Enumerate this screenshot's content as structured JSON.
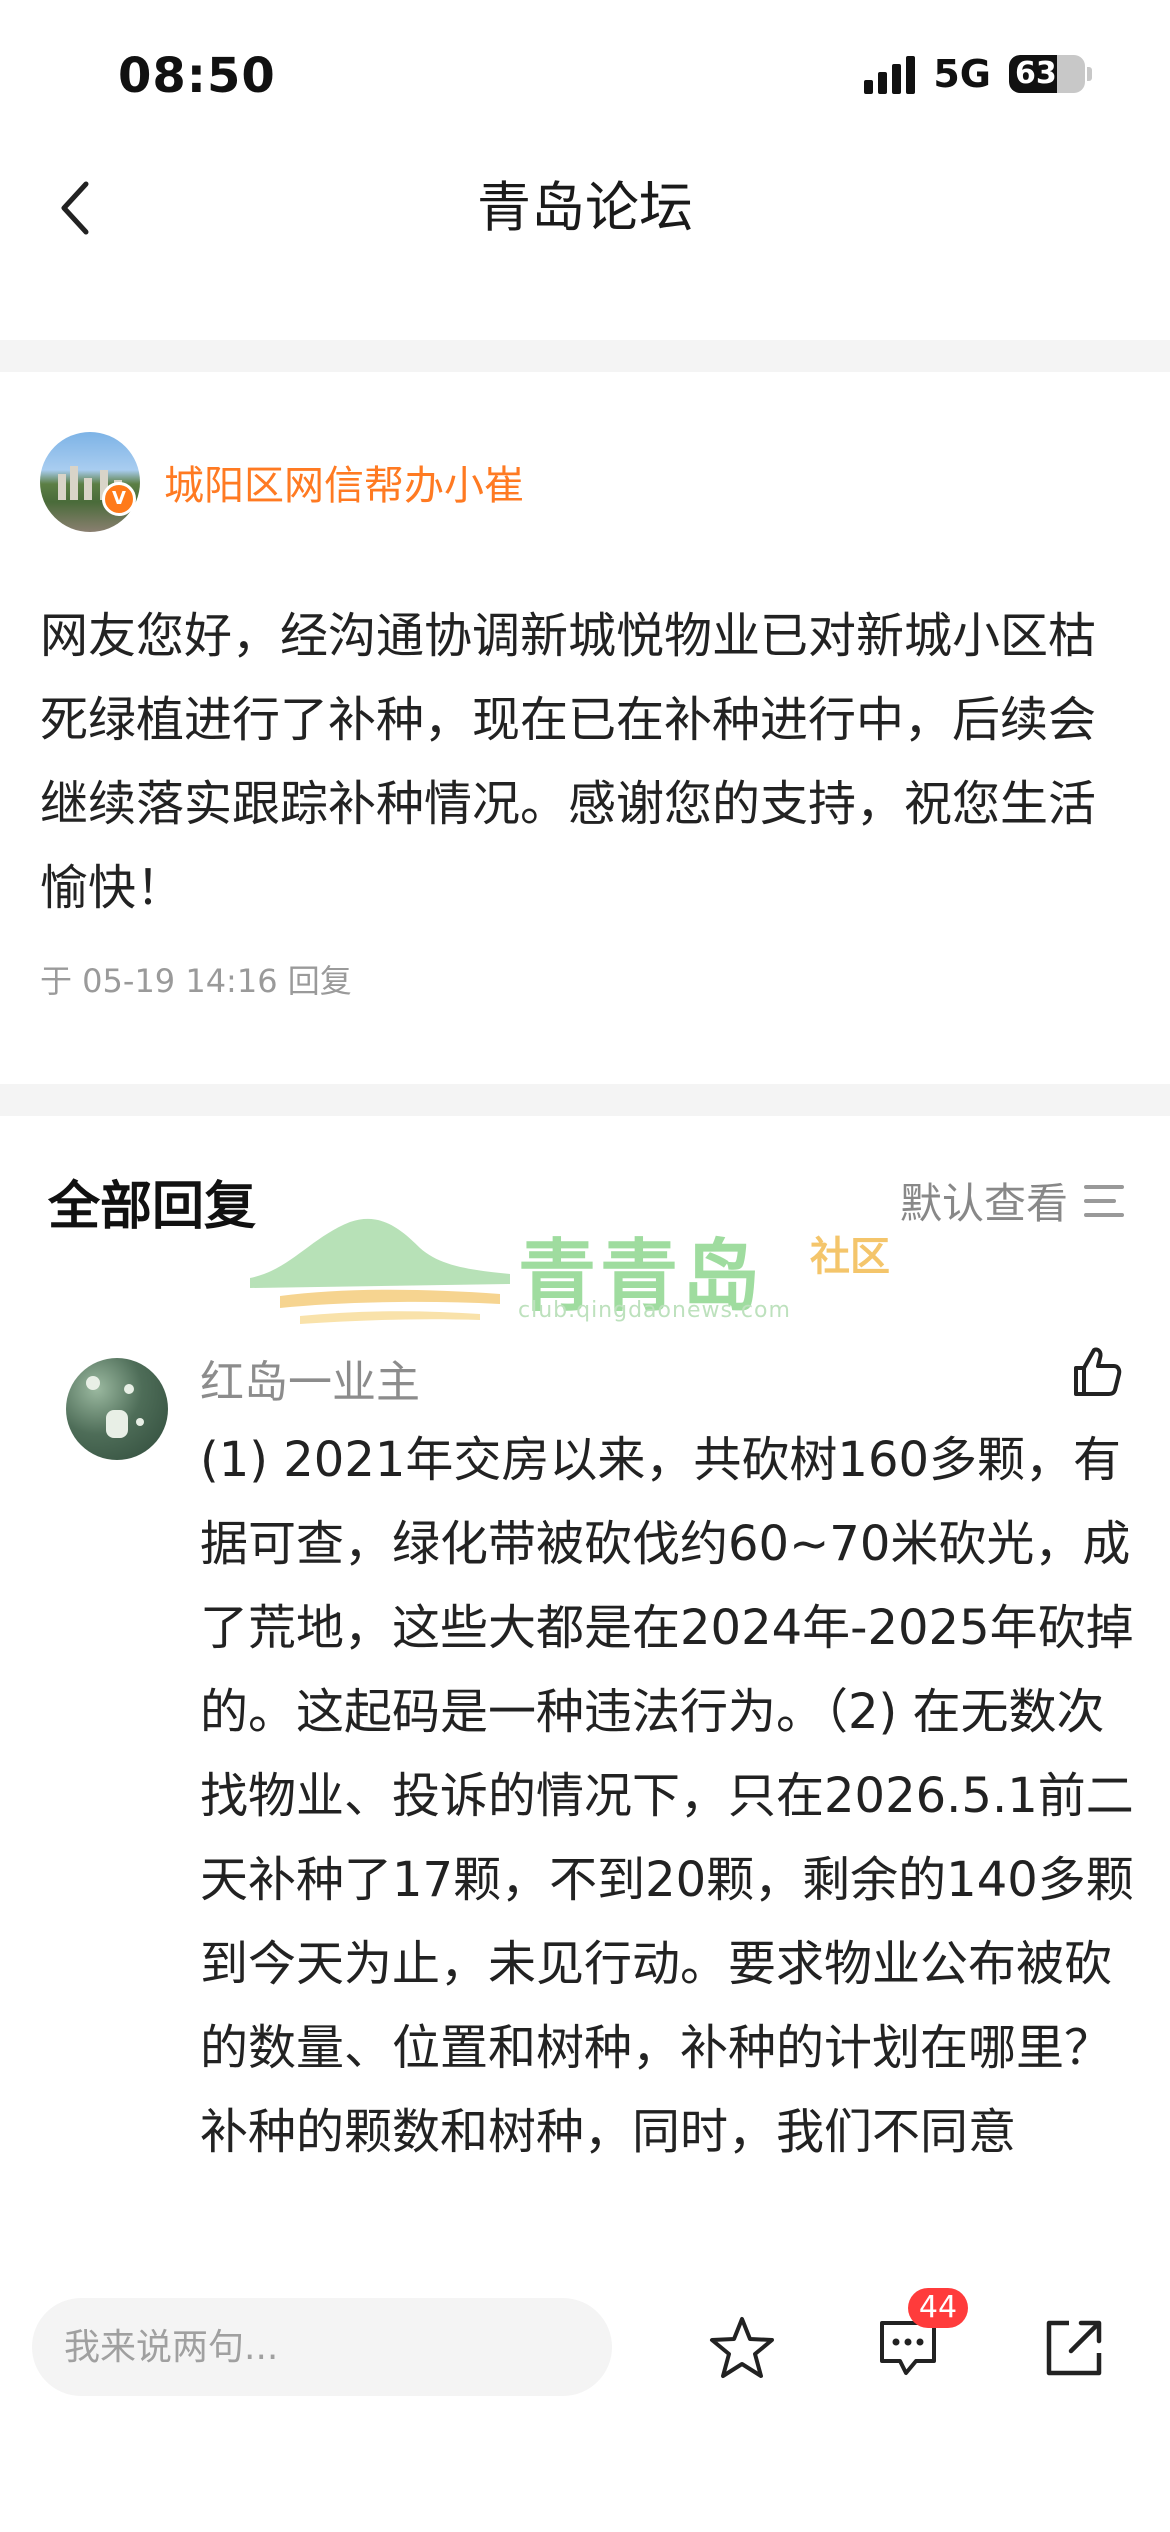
{
  "status_bar": {
    "time": "08:50",
    "network": "5G",
    "battery": "63",
    "battery_level": 0.63
  },
  "nav": {
    "title": "青岛论坛"
  },
  "official_reply": {
    "author": "城阳区网信帮办小崔",
    "badge": "V",
    "text": "网友您好，经沟通协调新城悦物业已对新城小区枯死绿植进行了补种，现在已在补种进行中，后续会继续落实跟踪补种情况。感谢您的支持，祝您生活愉快！",
    "meta": "于 05-19 14:16 回复"
  },
  "all_replies": {
    "title": "全部回复",
    "sort_label": "默认查看"
  },
  "watermark": {
    "brand": "青青岛",
    "sub": "社区",
    "url": "club.qingdaonews.com"
  },
  "comment": {
    "author": "红岛一业主",
    "text": "(1) 2021年交房以来，共砍树160多颗，有据可查，绿化带被砍伐约60~70米砍光，成了荒地，这些大都是在2024年-2025年砍掉的。这起码是一种违法行为。（2) 在无数次找物业、投诉的情况下，只在2026.5.1前二天补种了17颗，不到20颗，剩余的140多颗到今天为止，未见行动。要求物业公布被砍的数量、位置和树种，补种的计划在哪里？补种的颗数和树种，同时，我们不同意"
  },
  "bottom_bar": {
    "input_placeholder": "我来说两句...",
    "comment_count": "44"
  },
  "colors": {
    "accent": "#ff7a22",
    "badge": "#ff3b3b",
    "divider": "#f4f4f4"
  },
  "icons": [
    "back-chevron-icon",
    "signal-icon",
    "battery-icon",
    "verified-v-icon",
    "sort-lines-icon",
    "thumbs-up-icon",
    "star-icon",
    "comment-icon",
    "share-icon"
  ]
}
